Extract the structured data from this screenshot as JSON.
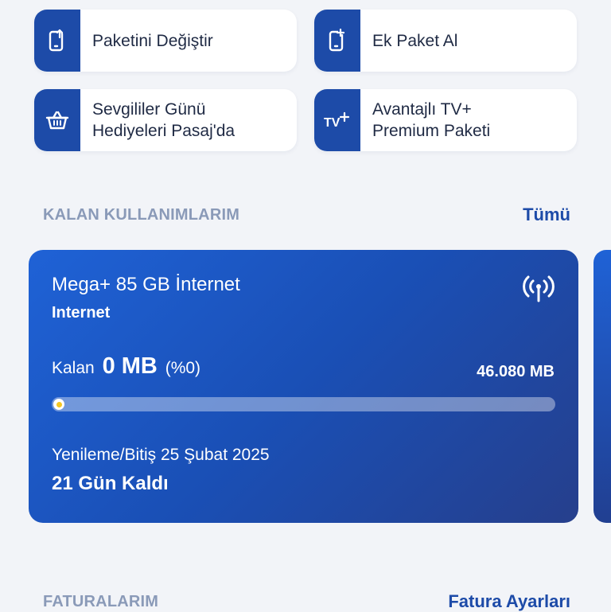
{
  "quick_actions": [
    {
      "label": "Paketini Değiştir",
      "icon": "phone-upload-icon"
    },
    {
      "label": "Ek Paket Al",
      "icon": "phone-add-icon"
    },
    {
      "label": "Sevgililer Günü\nHediyeleri Pasaj'da",
      "icon": "basket-icon"
    },
    {
      "label": "Avantajlı TV+\nPremium Paketi",
      "icon": "tv-plus-icon"
    }
  ],
  "usage_section": {
    "title": "KALAN KULLANIMLARIM",
    "link": "Tümü"
  },
  "usage_card": {
    "package_name": "Mega+ 85 GB İnternet",
    "type": "Internet",
    "remaining_prefix": "Kalan",
    "remaining_value": "0 MB",
    "remaining_percent": "(%0)",
    "progress": 0,
    "total": "46.080 MB",
    "renewal_text": "Yenileme/Bitiş 25 Şubat 2025",
    "days_left": "21 Gün Kaldı",
    "icon": "signal-antenna-icon"
  },
  "bills_section": {
    "title": "FATURALARIM",
    "link": "Fatura Ayarları"
  },
  "colors": {
    "accent": "#1d4ba8",
    "card_gradient_start": "#1f62d6",
    "card_gradient_end": "#263f8c",
    "section_title": "#8a9ab8",
    "progress_dot": "#f3c623"
  }
}
